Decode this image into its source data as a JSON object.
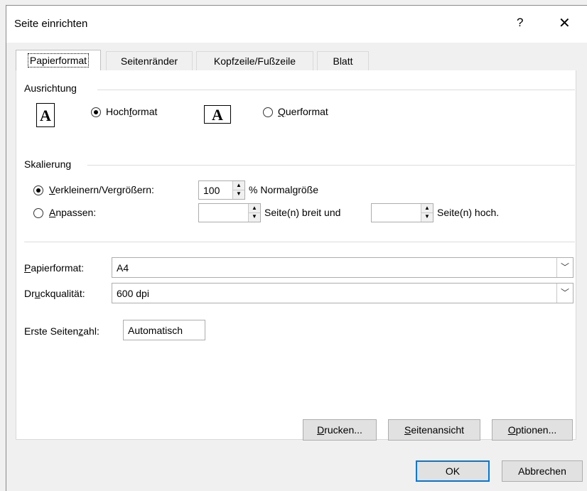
{
  "window": {
    "title": "Seite einrichten",
    "help_glyph": "?",
    "close_glyph": "✕"
  },
  "tabs": [
    {
      "label": "Papierformat",
      "active": true
    },
    {
      "label": "Seitenränder",
      "active": false
    },
    {
      "label": "Kopfzeile/Fußzeile",
      "active": false
    },
    {
      "label": "Blatt",
      "active": false
    }
  ],
  "orientation": {
    "group_label": "Ausrichtung",
    "portrait_label_pre": "Hoch",
    "portrait_label_u": "f",
    "portrait_label_post": "ormat",
    "landscape_label_pre": "",
    "landscape_label_u": "Q",
    "landscape_label_post": "uerformat",
    "icon_letter": "A",
    "selected": "portrait"
  },
  "scaling": {
    "group_label": "Skalierung",
    "adjust_label_u": "V",
    "adjust_label_post": "erkleinern/Vergrößern:",
    "adjust_value": "100",
    "adjust_suffix": "% Normalgröße",
    "fit_label_u": "A",
    "fit_label_post": "npassen:",
    "fit_wide_value": "",
    "fit_wide_suffix": "Seite(n) breit und",
    "fit_tall_value": "",
    "fit_tall_suffix": "Seite(n) hoch.",
    "selected": "adjust"
  },
  "paper": {
    "format_label_u": "P",
    "format_label_post": "apierformat:",
    "format_value": "A4",
    "quality_label_pre": "Dr",
    "quality_label_u": "u",
    "quality_label_post": "ckqualität:",
    "quality_value": "600 dpi",
    "first_page_label_pre": "Erste Seiten",
    "first_page_label_u": "z",
    "first_page_label_post": "ahl:",
    "first_page_value": "Automatisch"
  },
  "panel_buttons": {
    "print_u": "D",
    "print_post": "rucken...",
    "preview_u": "S",
    "preview_post": "eitenansicht",
    "options_u": "O",
    "options_post": "ptionen..."
  },
  "footer": {
    "ok": "OK",
    "cancel": "Abbrechen"
  },
  "icons": {
    "spin_up": "▲",
    "spin_down": "▼",
    "combo_arrow": "﹀"
  }
}
